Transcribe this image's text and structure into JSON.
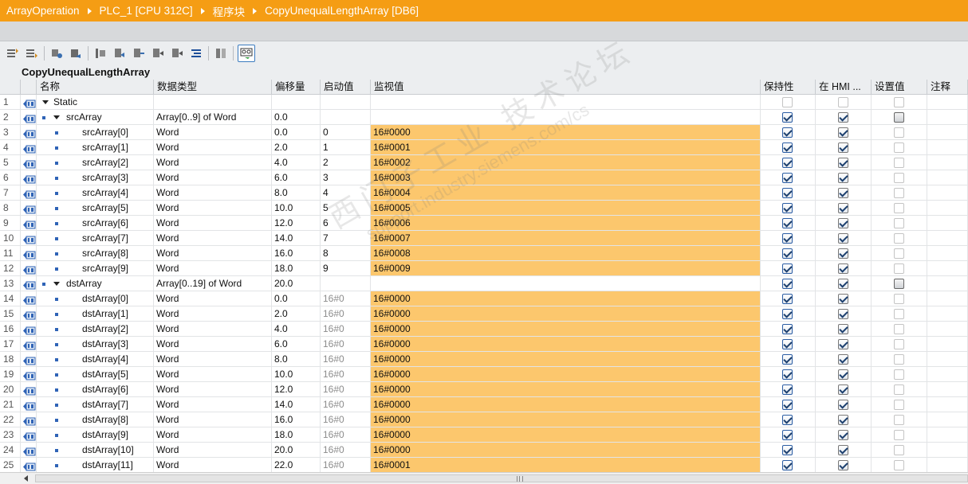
{
  "breadcrumb": [
    "ArrayOperation",
    "PLC_1 [CPU 312C]",
    "程序块",
    "CopyUnequalLengthArray [DB6]"
  ],
  "db_title": "CopyUnequalLengthArray",
  "columns": {
    "name": "名称",
    "datatype": "数据类型",
    "offset": "偏移量",
    "start": "启动值",
    "monitor": "监视值",
    "retain": "保持性",
    "hmi": "在 HMI ...",
    "setpoint": "设置值",
    "comment": "注释"
  },
  "watermark": {
    "line1": "西门子工业  技术论坛",
    "line2": "support.industry.siemens.com/cs"
  },
  "toolbar_icons": [
    "insert-row-icon",
    "add-row-icon",
    "expand-icon",
    "collapse-icon",
    "snapshot-icon",
    "copy-snapshot-icon",
    "load-snapshot-icon",
    "set-start-icon",
    "reset-start-icon",
    "monitor-values-icon",
    "compare-icon",
    "monitor-all-icon"
  ],
  "rows": [
    {
      "n": "1",
      "level": 0,
      "toggle": true,
      "bullet": false,
      "name": "Static",
      "type": "",
      "offset": "",
      "start": "",
      "start_grey": false,
      "monitor": "",
      "mon_bg": false,
      "retain": "dim",
      "hmi": "dim",
      "setpoint": "dim"
    },
    {
      "n": "2",
      "level": 1,
      "toggle": true,
      "bullet": true,
      "name": "srcArray",
      "type": "Array[0..9] of Word",
      "offset": "0.0",
      "start": "",
      "start_grey": false,
      "monitor": "",
      "mon_bg": false,
      "retain": "blue",
      "hmi": "on",
      "setpoint": "mixed"
    },
    {
      "n": "3",
      "level": 2,
      "toggle": false,
      "bullet": true,
      "name": "srcArray[0]",
      "type": "Word",
      "offset": "0.0",
      "start": "0",
      "start_grey": false,
      "monitor": "16#0000",
      "mon_bg": true,
      "retain": "blue",
      "hmi": "on",
      "setpoint": "dim"
    },
    {
      "n": "4",
      "level": 2,
      "toggle": false,
      "bullet": true,
      "name": "srcArray[1]",
      "type": "Word",
      "offset": "2.0",
      "start": "1",
      "start_grey": false,
      "monitor": "16#0001",
      "mon_bg": true,
      "retain": "blue",
      "hmi": "on",
      "setpoint": "dim"
    },
    {
      "n": "5",
      "level": 2,
      "toggle": false,
      "bullet": true,
      "name": "srcArray[2]",
      "type": "Word",
      "offset": "4.0",
      "start": "2",
      "start_grey": false,
      "monitor": "16#0002",
      "mon_bg": true,
      "retain": "blue",
      "hmi": "on",
      "setpoint": "dim"
    },
    {
      "n": "6",
      "level": 2,
      "toggle": false,
      "bullet": true,
      "name": "srcArray[3]",
      "type": "Word",
      "offset": "6.0",
      "start": "3",
      "start_grey": false,
      "monitor": "16#0003",
      "mon_bg": true,
      "retain": "blue",
      "hmi": "on",
      "setpoint": "dim"
    },
    {
      "n": "7",
      "level": 2,
      "toggle": false,
      "bullet": true,
      "name": "srcArray[4]",
      "type": "Word",
      "offset": "8.0",
      "start": "4",
      "start_grey": false,
      "monitor": "16#0004",
      "mon_bg": true,
      "retain": "blue",
      "hmi": "on",
      "setpoint": "dim"
    },
    {
      "n": "8",
      "level": 2,
      "toggle": false,
      "bullet": true,
      "name": "srcArray[5]",
      "type": "Word",
      "offset": "10.0",
      "start": "5",
      "start_grey": false,
      "monitor": "16#0005",
      "mon_bg": true,
      "retain": "blue",
      "hmi": "on",
      "setpoint": "dim"
    },
    {
      "n": "9",
      "level": 2,
      "toggle": false,
      "bullet": true,
      "name": "srcArray[6]",
      "type": "Word",
      "offset": "12.0",
      "start": "6",
      "start_grey": false,
      "monitor": "16#0006",
      "mon_bg": true,
      "retain": "blue",
      "hmi": "on",
      "setpoint": "dim"
    },
    {
      "n": "10",
      "level": 2,
      "toggle": false,
      "bullet": true,
      "name": "srcArray[7]",
      "type": "Word",
      "offset": "14.0",
      "start": "7",
      "start_grey": false,
      "monitor": "16#0007",
      "mon_bg": true,
      "retain": "blue",
      "hmi": "on",
      "setpoint": "dim"
    },
    {
      "n": "11",
      "level": 2,
      "toggle": false,
      "bullet": true,
      "name": "srcArray[8]",
      "type": "Word",
      "offset": "16.0",
      "start": "8",
      "start_grey": false,
      "monitor": "16#0008",
      "mon_bg": true,
      "retain": "blue",
      "hmi": "on",
      "setpoint": "dim"
    },
    {
      "n": "12",
      "level": 2,
      "toggle": false,
      "bullet": true,
      "name": "srcArray[9]",
      "type": "Word",
      "offset": "18.0",
      "start": "9",
      "start_grey": false,
      "monitor": "16#0009",
      "mon_bg": true,
      "retain": "blue",
      "hmi": "on",
      "setpoint": "dim"
    },
    {
      "n": "13",
      "level": 1,
      "toggle": true,
      "bullet": true,
      "name": "dstArray",
      "type": "Array[0..19] of Word",
      "offset": "20.0",
      "start": "",
      "start_grey": false,
      "monitor": "",
      "mon_bg": false,
      "retain": "blue",
      "hmi": "on",
      "setpoint": "mixed"
    },
    {
      "n": "14",
      "level": 2,
      "toggle": false,
      "bullet": true,
      "name": "dstArray[0]",
      "type": "Word",
      "offset": "0.0",
      "start": "16#0",
      "start_grey": true,
      "monitor": "16#0000",
      "mon_bg": true,
      "retain": "blue",
      "hmi": "on",
      "setpoint": "dim"
    },
    {
      "n": "15",
      "level": 2,
      "toggle": false,
      "bullet": true,
      "name": "dstArray[1]",
      "type": "Word",
      "offset": "2.0",
      "start": "16#0",
      "start_grey": true,
      "monitor": "16#0000",
      "mon_bg": true,
      "retain": "blue",
      "hmi": "on",
      "setpoint": "dim"
    },
    {
      "n": "16",
      "level": 2,
      "toggle": false,
      "bullet": true,
      "name": "dstArray[2]",
      "type": "Word",
      "offset": "4.0",
      "start": "16#0",
      "start_grey": true,
      "monitor": "16#0000",
      "mon_bg": true,
      "retain": "blue",
      "hmi": "on",
      "setpoint": "dim"
    },
    {
      "n": "17",
      "level": 2,
      "toggle": false,
      "bullet": true,
      "name": "dstArray[3]",
      "type": "Word",
      "offset": "6.0",
      "start": "16#0",
      "start_grey": true,
      "monitor": "16#0000",
      "mon_bg": true,
      "retain": "blue",
      "hmi": "on",
      "setpoint": "dim"
    },
    {
      "n": "18",
      "level": 2,
      "toggle": false,
      "bullet": true,
      "name": "dstArray[4]",
      "type": "Word",
      "offset": "8.0",
      "start": "16#0",
      "start_grey": true,
      "monitor": "16#0000",
      "mon_bg": true,
      "retain": "blue",
      "hmi": "on",
      "setpoint": "dim"
    },
    {
      "n": "19",
      "level": 2,
      "toggle": false,
      "bullet": true,
      "name": "dstArray[5]",
      "type": "Word",
      "offset": "10.0",
      "start": "16#0",
      "start_grey": true,
      "monitor": "16#0000",
      "mon_bg": true,
      "retain": "blue",
      "hmi": "on",
      "setpoint": "dim"
    },
    {
      "n": "20",
      "level": 2,
      "toggle": false,
      "bullet": true,
      "name": "dstArray[6]",
      "type": "Word",
      "offset": "12.0",
      "start": "16#0",
      "start_grey": true,
      "monitor": "16#0000",
      "mon_bg": true,
      "retain": "blue",
      "hmi": "on",
      "setpoint": "dim"
    },
    {
      "n": "21",
      "level": 2,
      "toggle": false,
      "bullet": true,
      "name": "dstArray[7]",
      "type": "Word",
      "offset": "14.0",
      "start": "16#0",
      "start_grey": true,
      "monitor": "16#0000",
      "mon_bg": true,
      "retain": "blue",
      "hmi": "on",
      "setpoint": "dim"
    },
    {
      "n": "22",
      "level": 2,
      "toggle": false,
      "bullet": true,
      "name": "dstArray[8]",
      "type": "Word",
      "offset": "16.0",
      "start": "16#0",
      "start_grey": true,
      "monitor": "16#0000",
      "mon_bg": true,
      "retain": "blue",
      "hmi": "on",
      "setpoint": "dim"
    },
    {
      "n": "23",
      "level": 2,
      "toggle": false,
      "bullet": true,
      "name": "dstArray[9]",
      "type": "Word",
      "offset": "18.0",
      "start": "16#0",
      "start_grey": true,
      "monitor": "16#0000",
      "mon_bg": true,
      "retain": "blue",
      "hmi": "on",
      "setpoint": "dim"
    },
    {
      "n": "24",
      "level": 2,
      "toggle": false,
      "bullet": true,
      "name": "dstArray[10]",
      "type": "Word",
      "offset": "20.0",
      "start": "16#0",
      "start_grey": true,
      "monitor": "16#0000",
      "mon_bg": true,
      "retain": "blue",
      "hmi": "on",
      "setpoint": "dim"
    },
    {
      "n": "25",
      "level": 2,
      "toggle": false,
      "bullet": true,
      "name": "dstArray[11]",
      "type": "Word",
      "offset": "22.0",
      "start": "16#0",
      "start_grey": true,
      "monitor": "16#0001",
      "mon_bg": true,
      "retain": "blue",
      "hmi": "on",
      "setpoint": "dim"
    }
  ]
}
